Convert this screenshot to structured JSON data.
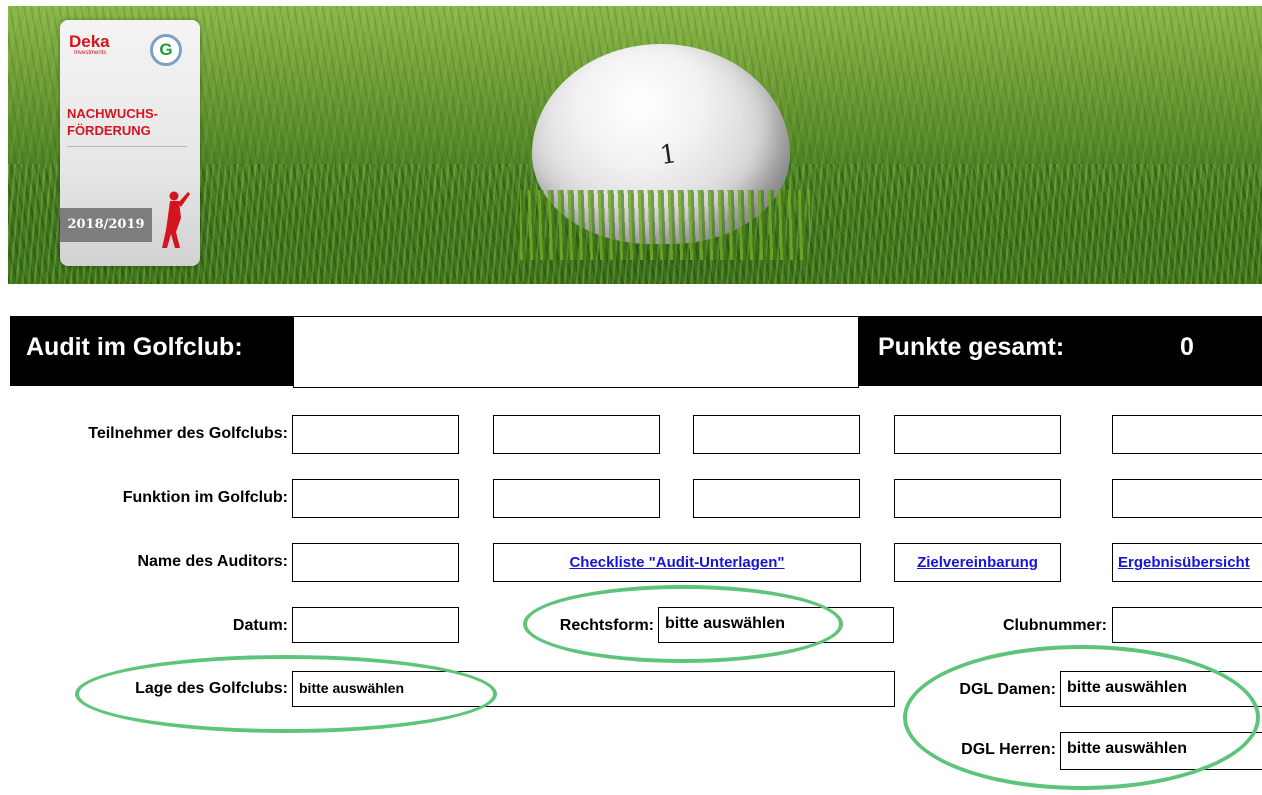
{
  "badge": {
    "brand": "Deka",
    "brand_sub": "Investments",
    "g_logo": "G",
    "line1": "NACHWUCHS-",
    "line2": "FÖRDERUNG",
    "season": "2018/2019"
  },
  "banner": {
    "ball_number": "1"
  },
  "header": {
    "title": "Audit im Golfclub:",
    "points_label": "Punkte gesamt:",
    "points_value": "0"
  },
  "form": {
    "participants_label": "Teilnehmer des Golfclubs:",
    "function_label": "Funktion im Golfclub:",
    "auditor_label": "Name des Auditors:",
    "date_label": "Datum:",
    "legal_form_label": "Rechtsform:",
    "legal_form_value": "bitte auswählen",
    "club_number_label": "Clubnummer:",
    "location_label": "Lage des Golfclubs:",
    "location_value": "bitte auswählen",
    "dgl_women_label": "DGL Damen:",
    "dgl_women_value": "bitte auswählen",
    "dgl_men_label": "DGL Herren:",
    "dgl_men_value": "bitte auswählen"
  },
  "links": {
    "checklist": "Checkliste \"Audit-Unterlagen\"",
    "target_agreement": "Zielvereinbarung",
    "results": "Ergebnisübersicht"
  },
  "colors": {
    "annotation": "#5ec47a",
    "link": "#1515d6",
    "brand_red": "#d4141e"
  }
}
